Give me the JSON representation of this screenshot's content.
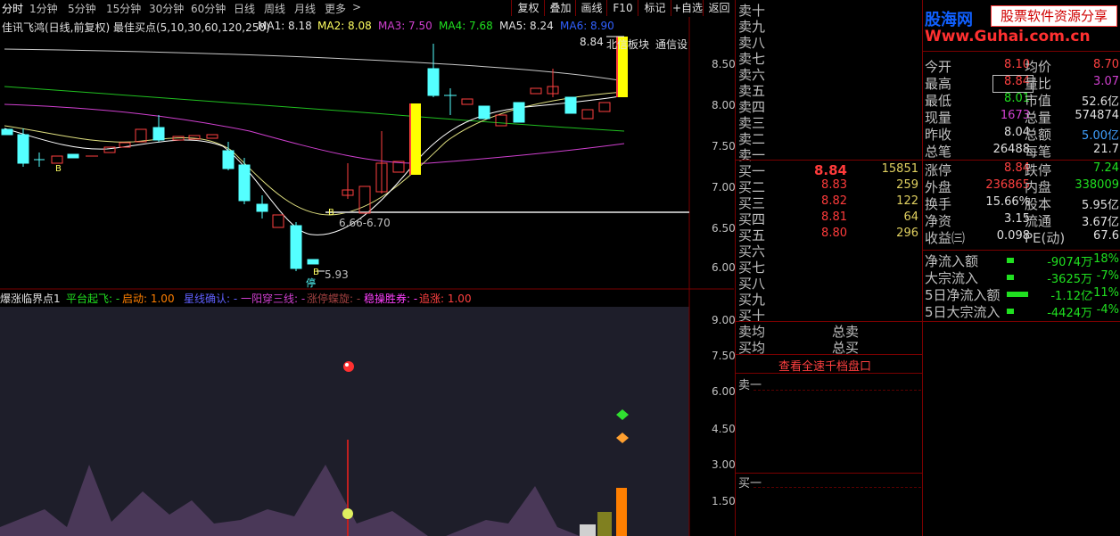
{
  "toolbar": {
    "periods": [
      "分时",
      "1分钟",
      "5分钟",
      "15分钟",
      "30分钟",
      "60分钟",
      "日线",
      "周线",
      "月线",
      "更多"
    ],
    "more_arrow": ">",
    "buttons": [
      "复权",
      "叠加",
      "画线",
      "F10",
      "标记",
      "+自选",
      "返回"
    ]
  },
  "kline_legend": {
    "title": "佳讯飞鸿(日线,前复权) 最佳买点(5,10,30,60,120,250)",
    "ma1": "MA1: 8.18",
    "ma2": "MA2: 8.08",
    "ma3": "MA3: 7.50",
    "ma4": "MA4: 7.68",
    "ma5": "MA5: 8.24",
    "ma6": "MA6: 8.90",
    "sector": "北信板块",
    "settings": "通信设"
  },
  "kline_annotations": {
    "high": "8.84",
    "range": "6.66-6.70",
    "low": "5.93",
    "b1": "B",
    "b2": "B",
    "b3": "B",
    "stop": "停"
  },
  "kline_axis": [
    "8.50",
    "8.00",
    "7.50",
    "7.00",
    "6.50",
    "6.00"
  ],
  "ind_legend": {
    "title": "爆涨临界点1",
    "pt": "平台起飞: -",
    "qd": "启动: 1.00",
    "xx": "星线确认: -",
    "yy": "一阳穿三线: -",
    "zt": "涨停蝶旋: -",
    "wc": "稳操胜券: -",
    "zz": "追涨: 1.00"
  },
  "ind_axis": [
    "9.00",
    "7.50",
    "6.00",
    "4.50",
    "3.00",
    "1.50"
  ],
  "orderbook": {
    "sell_labels": [
      "卖十",
      "卖九",
      "卖八",
      "卖七",
      "卖六",
      "卖五",
      "卖四",
      "卖三",
      "卖二",
      "卖一"
    ],
    "buy_labels": [
      "买一",
      "买二",
      "买三",
      "买四",
      "买五",
      "买六",
      "买七",
      "买八",
      "买九",
      "买十"
    ],
    "buy_prices": [
      "8.84",
      "8.83",
      "8.82",
      "8.81",
      "8.80"
    ],
    "buy_vols": [
      "15851",
      "259",
      "122",
      "64",
      "296"
    ],
    "sell_avg": "卖均",
    "buy_avg": "买均",
    "total_sell": "总卖",
    "total_buy": "总买",
    "full_depth": "查看全速千档盘口",
    "sell1": "卖一",
    "buy1": "买一"
  },
  "logo": {
    "name": "股海网",
    "slogan": "股票软件资源分享",
    "url": "Www.Guhai.com.cn"
  },
  "quote": {
    "rows1": [
      {
        "l1": "今开",
        "v1": "8.10",
        "c1": "#ff4040",
        "l2": "均价",
        "v2": "8.70",
        "c2": "#ff4040"
      },
      {
        "l1": "最高",
        "v1": "8.84",
        "c1": "#ff4040",
        "l2": "量比",
        "v2": "3.07",
        "c2": "#d040d0"
      },
      {
        "l1": "最低",
        "v1": "8.01",
        "c1": "#20e020",
        "l2": "市值",
        "v2": "52.6亿",
        "c2": "#e0e0e0"
      },
      {
        "l1": "现量",
        "v1": "1673",
        "c1": "#d040d0",
        "l2": "总量",
        "v2": "574874",
        "c2": "#e0e0e0"
      },
      {
        "l1": "昨收",
        "v1": "8.04",
        "c1": "#e0e0e0",
        "l2": "总额",
        "v2": "5.00亿",
        "c2": "#40a0ff"
      },
      {
        "l1": "总笔",
        "v1": "26488",
        "c1": "#e0e0e0",
        "l2": "每笔",
        "v2": "21.7",
        "c2": "#e0e0e0"
      }
    ],
    "rows2": [
      {
        "l1": "涨停",
        "v1": "8.84",
        "c1": "#ff4040",
        "l2": "跌停",
        "v2": "7.24",
        "c2": "#20e020"
      },
      {
        "l1": "外盘",
        "v1": "236865",
        "c1": "#ff4040",
        "l2": "内盘",
        "v2": "338009",
        "c2": "#20e020"
      },
      {
        "l1": "换手",
        "v1": "15.66%",
        "c1": "#e0e0e0",
        "l2": "股本",
        "v2": "5.95亿",
        "c2": "#e0e0e0"
      },
      {
        "l1": "净资",
        "v1": "3.15",
        "c1": "#e0e0e0",
        "l2": "流通",
        "v2": "3.67亿",
        "c2": "#e0e0e0"
      },
      {
        "l1": "收益㈢",
        "v1": "0.098",
        "c1": "#e0e0e0",
        "l2": "PE(动)",
        "v2": "67.6",
        "c2": "#e0e0e0"
      }
    ],
    "flows": [
      {
        "label": "净流入额",
        "value": "-9074万",
        "pct": "-18%",
        "bar": 0.25
      },
      {
        "label": "大宗流入",
        "value": "-3625万",
        "pct": "-7%",
        "bar": 0.25
      },
      {
        "label": "5日净流入额",
        "value": "-1.12亿",
        "pct": "-11%",
        "bar": 0.8
      },
      {
        "label": "5日大宗流入",
        "value": "-4424万",
        "pct": "-4%",
        "bar": 0.25
      }
    ]
  },
  "colors": {
    "up": "#ff4040",
    "down": "#54ffff",
    "frame": "#7a0000",
    "yellow": "#ffff00"
  }
}
